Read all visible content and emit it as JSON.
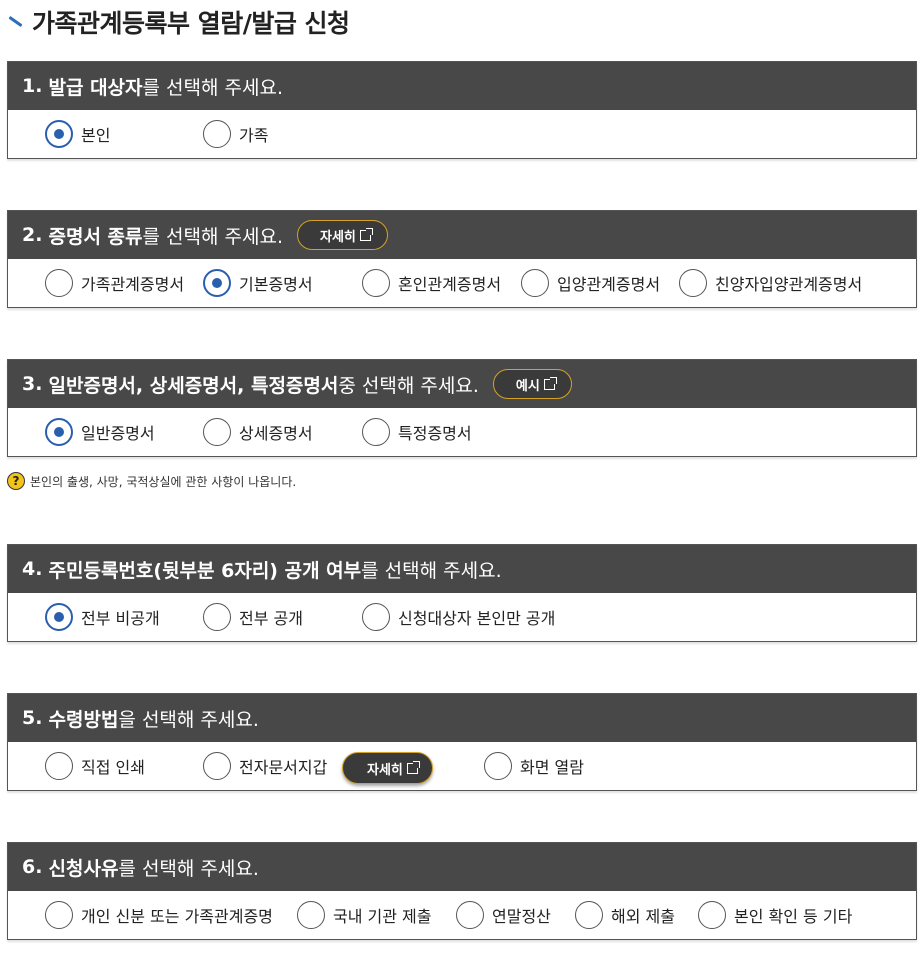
{
  "page": {
    "title": "가족관계등록부 열람/발급 신청"
  },
  "sections": [
    {
      "number": "1.",
      "bold": "발급 대상자",
      "rest": "를 선택해 주세요.",
      "options": [
        {
          "label": "본인",
          "selected": true
        },
        {
          "label": "가족",
          "selected": false
        }
      ]
    },
    {
      "number": "2.",
      "bold": "증명서 종류",
      "rest": "를 선택해 주세요.",
      "button": "자세히",
      "options": [
        {
          "label": "가족관계증명서",
          "selected": false
        },
        {
          "label": "기본증명서",
          "selected": true
        },
        {
          "label": "혼인관계증명서",
          "selected": false
        },
        {
          "label": "입양관계증명서",
          "selected": false
        },
        {
          "label": "친양자입양관계증명서",
          "selected": false
        }
      ]
    },
    {
      "number": "3.",
      "bold": "일반증명서, 상세증명서, 특정증명서",
      "rest": " 중 선택해 주세요.",
      "button": "예시",
      "options": [
        {
          "label": "일반증명서",
          "selected": true
        },
        {
          "label": "상세증명서",
          "selected": false
        },
        {
          "label": "특정증명서",
          "selected": false
        }
      ]
    },
    {
      "number": "4.",
      "bold": "주민등록번호(뒷부분 6자리) 공개 여부",
      "rest": "를 선택해 주세요.",
      "options": [
        {
          "label": "전부 비공개",
          "selected": true
        },
        {
          "label": "전부 공개",
          "selected": false
        },
        {
          "label": "신청대상자 본인만 공개",
          "selected": false
        }
      ]
    },
    {
      "number": "5.",
      "bold": "수령방법",
      "rest": "을 선택해 주세요.",
      "inline_button": "자세히",
      "options": [
        {
          "label": "직접 인쇄",
          "selected": false
        },
        {
          "label": "전자문서지갑",
          "selected": false
        },
        {
          "label": "화면 열람",
          "selected": false
        }
      ]
    },
    {
      "number": "6.",
      "bold": "신청사유",
      "rest": "를 선택해 주세요.",
      "options": [
        {
          "label": "개인 신분 또는 가족관계증명",
          "selected": false
        },
        {
          "label": "국내 기관 제출",
          "selected": false
        },
        {
          "label": "연말정산",
          "selected": false
        },
        {
          "label": "해외 제출",
          "selected": false
        },
        {
          "label": "본인 확인 등 기타",
          "selected": false
        }
      ]
    }
  ],
  "note": {
    "icon": "question-icon",
    "text": "본인의 출생, 사망, 국적상실에 관한 사항이 나옵니다."
  },
  "colors": {
    "header_bg": "#484848",
    "radio_selected": "#2a5fae",
    "button_border": "#d4a326",
    "help_icon": "#f2c318"
  }
}
